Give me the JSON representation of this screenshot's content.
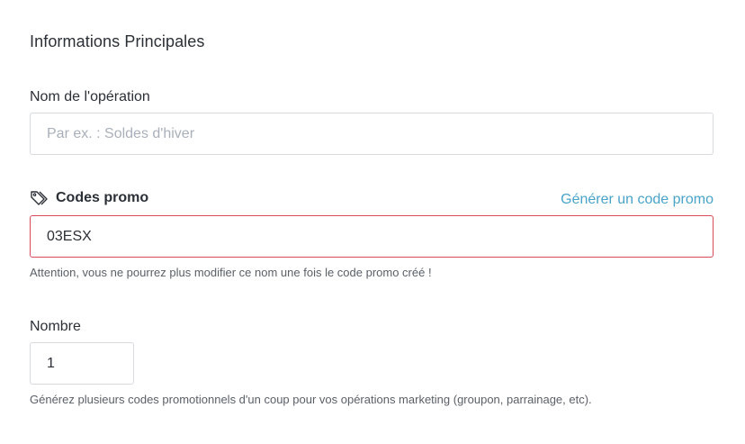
{
  "section": {
    "title": "Informations Principales"
  },
  "operation_name": {
    "label": "Nom de l'opération",
    "value": "",
    "placeholder": "Par ex. : Soldes d'hiver"
  },
  "promo_codes": {
    "label": "Codes promo",
    "icon": "tag-icon",
    "generate_link": "Générer un code promo",
    "value": "03ESX",
    "error_color": "#d94b5b",
    "hint": "Attention, vous ne pourrez plus modifier ce nom une fois le code promo créé !"
  },
  "count": {
    "label": "Nombre",
    "value": "1",
    "hint": "Générez plusieurs codes promotionnels d'un coup pour vos opérations marketing (groupon, parrainage, etc)."
  },
  "colors": {
    "link": "#4aa3c8",
    "text": "#2b2f36",
    "border": "#d7dbe0"
  }
}
